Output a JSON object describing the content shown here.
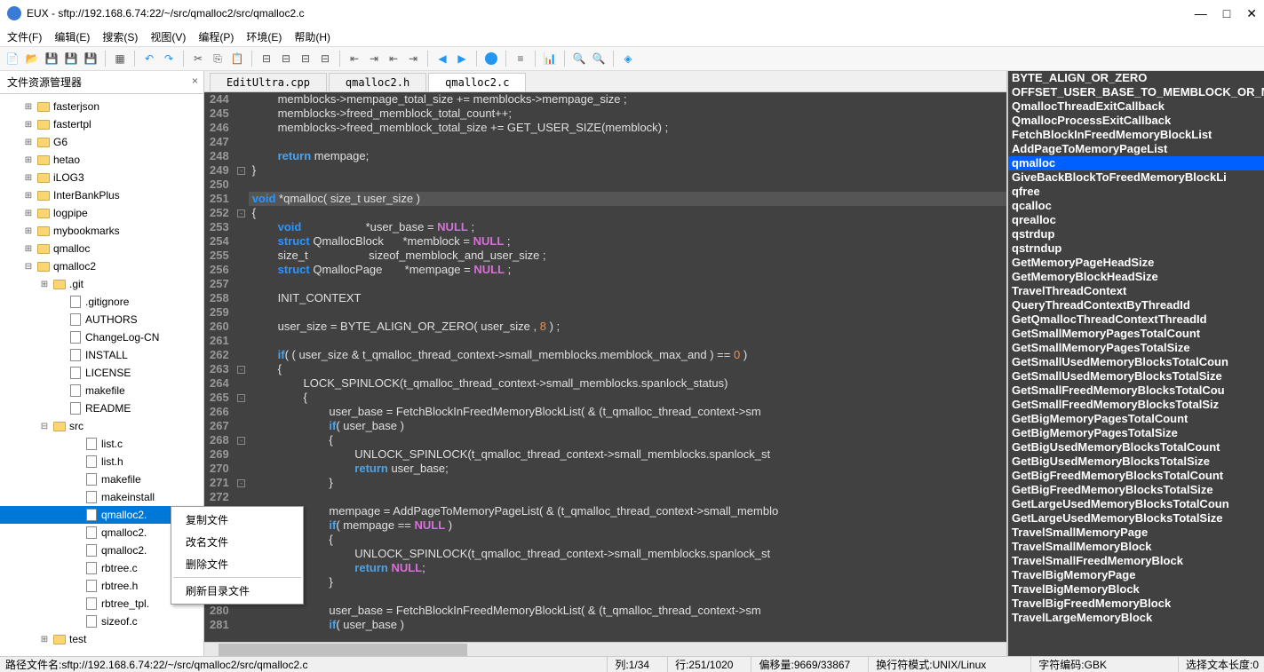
{
  "title": "EUX - sftp://192.168.6.74:22/~/src/qmalloc2/src/qmalloc2.c",
  "menu": [
    "文件(F)",
    "编辑(E)",
    "搜索(S)",
    "视图(V)",
    "编程(P)",
    "环境(E)",
    "帮助(H)"
  ],
  "sidebar_title": "文件资源管理器",
  "tree": [
    {
      "l": 1,
      "t": "folder",
      "e": "+",
      "n": "fasterjson"
    },
    {
      "l": 1,
      "t": "folder",
      "e": "+",
      "n": "fastertpl"
    },
    {
      "l": 1,
      "t": "folder",
      "e": "+",
      "n": "G6"
    },
    {
      "l": 1,
      "t": "folder",
      "e": "+",
      "n": "hetao"
    },
    {
      "l": 1,
      "t": "folder",
      "e": "+",
      "n": "iLOG3"
    },
    {
      "l": 1,
      "t": "folder",
      "e": "+",
      "n": "InterBankPlus"
    },
    {
      "l": 1,
      "t": "folder",
      "e": "+",
      "n": "logpipe"
    },
    {
      "l": 1,
      "t": "folder",
      "e": "+",
      "n": "mybookmarks"
    },
    {
      "l": 1,
      "t": "folder",
      "e": "+",
      "n": "qmalloc"
    },
    {
      "l": 1,
      "t": "folder",
      "e": "-",
      "n": "qmalloc2"
    },
    {
      "l": 2,
      "t": "folder",
      "e": "+",
      "n": ".git"
    },
    {
      "l": 3,
      "t": "file",
      "n": ".gitignore"
    },
    {
      "l": 3,
      "t": "file",
      "n": "AUTHORS"
    },
    {
      "l": 3,
      "t": "file",
      "n": "ChangeLog-CN"
    },
    {
      "l": 3,
      "t": "file",
      "n": "INSTALL"
    },
    {
      "l": 3,
      "t": "file",
      "n": "LICENSE"
    },
    {
      "l": 3,
      "t": "file",
      "n": "makefile"
    },
    {
      "l": 3,
      "t": "file",
      "n": "README"
    },
    {
      "l": 2,
      "t": "folder",
      "e": "-",
      "n": "src"
    },
    {
      "l": 4,
      "t": "file",
      "n": "list.c"
    },
    {
      "l": 4,
      "t": "file",
      "n": "list.h"
    },
    {
      "l": 4,
      "t": "file",
      "n": "makefile"
    },
    {
      "l": 4,
      "t": "file",
      "n": "makeinstall"
    },
    {
      "l": 4,
      "t": "file",
      "n": "qmalloc2.",
      "sel": true
    },
    {
      "l": 4,
      "t": "file",
      "n": "qmalloc2."
    },
    {
      "l": 4,
      "t": "file",
      "n": "qmalloc2."
    },
    {
      "l": 4,
      "t": "file",
      "n": "rbtree.c"
    },
    {
      "l": 4,
      "t": "file",
      "n": "rbtree.h"
    },
    {
      "l": 4,
      "t": "file",
      "n": "rbtree_tpl."
    },
    {
      "l": 4,
      "t": "file",
      "n": "sizeof.c"
    },
    {
      "l": 2,
      "t": "folder",
      "e": "+",
      "n": "test"
    }
  ],
  "tabs": [
    {
      "label": "EditUltra.cpp",
      "active": false
    },
    {
      "label": "qmalloc2.h",
      "active": false
    },
    {
      "label": "qmalloc2.c",
      "active": true
    }
  ],
  "context_menu": [
    "复制文件",
    "改名文件",
    "删除文件",
    "—",
    "刷新目录文件"
  ],
  "symbols": [
    "BYTE_ALIGN_OR_ZERO",
    "OFFSET_USER_BASE_TO_MEMBLOCK_OR_N",
    "QmallocThreadExitCallback",
    "QmallocProcessExitCallback",
    "FetchBlockInFreedMemoryBlockList",
    "AddPageToMemoryPageList",
    "qmalloc",
    "GiveBackBlockToFreedMemoryBlockLi",
    "qfree",
    "qcalloc",
    "qrealloc",
    "qstrdup",
    "qstrndup",
    "GetMemoryPageHeadSize",
    "GetMemoryBlockHeadSize",
    "TravelThreadContext",
    "QueryThreadContextByThreadId",
    "GetQmallocThreadContextThreadId",
    "GetSmallMemoryPagesTotalCount",
    "GetSmallMemoryPagesTotalSize",
    "GetSmallUsedMemoryBlocksTotalCoun",
    "GetSmallUsedMemoryBlocksTotalSize",
    "GetSmallFreedMemoryBlocksTotalCou",
    "GetSmallFreedMemoryBlocksTotalSiz",
    "GetBigMemoryPagesTotalCount",
    "GetBigMemoryPagesTotalSize",
    "GetBigUsedMemoryBlocksTotalCount",
    "GetBigUsedMemoryBlocksTotalSize",
    "GetBigFreedMemoryBlocksTotalCount",
    "GetBigFreedMemoryBlocksTotalSize",
    "GetLargeUsedMemoryBlocksTotalCoun",
    "GetLargeUsedMemoryBlocksTotalSize",
    "TravelSmallMemoryPage",
    "TravelSmallMemoryBlock",
    "TravelSmallFreedMemoryBlock",
    "TravelBigMemoryPage",
    "TravelBigMemoryBlock",
    "TravelBigFreedMemoryBlock",
    "TravelLargeMemoryBlock"
  ],
  "symbol_selected": "qmalloc",
  "line_start": 244,
  "line_end": 281,
  "highlighted_line": 251,
  "status": {
    "path_label": "路径文件名:",
    "path": "sftp://192.168.6.74:22/~/src/qmalloc2/src/qmalloc2.c",
    "col_label": "列:",
    "col": "1/34",
    "row_label": "行:",
    "row": "251/1020",
    "offset_label": "偏移量:",
    "offset": "9669/33867",
    "newline_label": "换行符模式:",
    "newline": "UNIX/Linux",
    "encoding_label": "字符编码:",
    "encoding": "GBK",
    "sel_label": "选择文本长度:",
    "sel": "0"
  }
}
